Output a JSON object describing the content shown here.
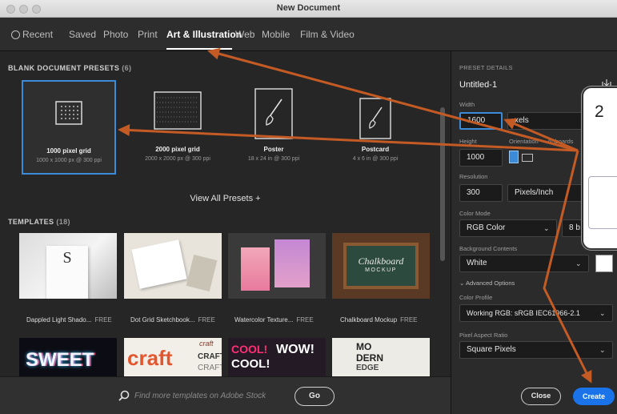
{
  "window": {
    "title": "New Document"
  },
  "tabs": [
    "Recent",
    "Saved",
    "Photo",
    "Print",
    "Art & Illustration",
    "Web",
    "Mobile",
    "Film & Video"
  ],
  "presets": {
    "heading": "BLANK DOCUMENT PRESETS",
    "count": "(6)",
    "items": [
      {
        "name": "1000 pixel grid",
        "dims": "1000 x 1000 px @ 300 ppi"
      },
      {
        "name": "2000 pixel grid",
        "dims": "2000 x 2000 px @ 300 ppi"
      },
      {
        "name": "Poster",
        "dims": "18 x 24 in @ 300 ppi"
      },
      {
        "name": "Postcard",
        "dims": "4 x 6 in @ 300 ppi"
      }
    ],
    "view_all": "View All Presets +"
  },
  "templates": {
    "heading": "TEMPLATES",
    "count": "(18)",
    "free_label": "FREE",
    "items": [
      {
        "name": "Dappled Light Shado..."
      },
      {
        "name": "Dot Grid Sketchbook..."
      },
      {
        "name": "Watercolor Texture..."
      },
      {
        "name": "Chalkboard Mockup"
      }
    ],
    "row2_words": [
      "SWEET",
      "craft",
      "craft",
      "CRAFT",
      "CRAFT",
      "COOL!",
      "COOL!",
      "WOW!",
      "MO",
      "DERN",
      "EDGE"
    ],
    "card_art_text": {
      "s_letter": "S",
      "chalk_title": "Chalkboard",
      "chalk_sub": "MOCKUP"
    }
  },
  "stock": {
    "placeholder": "Find more templates on Adobe Stock",
    "go_label": "Go"
  },
  "details": {
    "heading": "PRESET DETAILS",
    "doc_name": "Untitled-1",
    "width_label": "Width",
    "width_value": "1600",
    "width_unit": "xels",
    "height_label": "Height",
    "height_value": "1000",
    "orientation_label": "Orientation",
    "artboards_label": "Artboards",
    "resolution_label": "Resolution",
    "resolution_value": "300",
    "resolution_unit": "Pixels/Inch",
    "color_mode_label": "Color Mode",
    "color_mode_value": "RGB Color",
    "bit_depth": "8 b",
    "bg_label": "Background Contents",
    "bg_value": "White",
    "advanced_label": "Advanced Options",
    "profile_label": "Color Profile",
    "profile_value": "Working RGB: sRGB IEC61966-2.1",
    "aspect_label": "Pixel Aspect Ratio",
    "aspect_value": "Square Pixels"
  },
  "buttons": {
    "close": "Close",
    "create": "Create"
  },
  "callout": {
    "number": "2"
  },
  "colors": {
    "accent": "#1a73e8",
    "selection": "#3b8bd8",
    "arrow": "#c45a24"
  }
}
